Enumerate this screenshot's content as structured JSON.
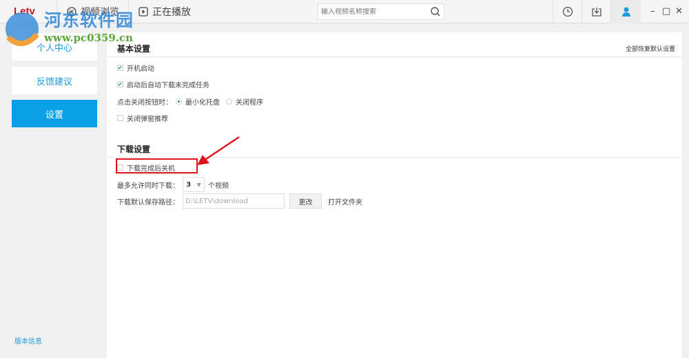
{
  "topbar": {
    "logo": "Letv",
    "tabs": [
      {
        "label": "视频浏览",
        "icon": "browse-icon"
      },
      {
        "label": "正在播放",
        "icon": "play-icon"
      }
    ],
    "search_placeholder": "输入视频名称搜索",
    "icons": [
      "history-icon",
      "download-icon",
      "user-icon"
    ],
    "window": {
      "minimize": "–",
      "maximize": "□",
      "close": "✕"
    },
    "accent": "#0aa0e6"
  },
  "sidebar": {
    "items": [
      {
        "label": "个人中心"
      },
      {
        "label": "反馈建议"
      },
      {
        "label": "设置",
        "active": true
      }
    ],
    "version": "版本信息"
  },
  "basic": {
    "title": "基本设置",
    "reset": "全部恢复默认设置",
    "autostart": {
      "label": "开机启动",
      "checked": true
    },
    "resume": {
      "label": "启动后自动下载未完成任务",
      "checked": true
    },
    "close_action": {
      "label": "点击关闭按钮时：",
      "options": [
        {
          "label": "最小化托盘",
          "selected": true
        },
        {
          "label": "关闭程序",
          "selected": false
        }
      ]
    },
    "popup": {
      "label": "关闭弹窗推荐",
      "checked": false
    }
  },
  "download": {
    "title": "下载设置",
    "shutdown": {
      "label": "下载完成后关机",
      "checked": false
    },
    "max_label": "最多允许同时下载：",
    "max_value": "3",
    "max_unit": "个视频",
    "path_label": "下载默认保存路径：",
    "path_value": "D:\\LETV\\download",
    "change": "更改",
    "open_folder": "打开文件夹"
  },
  "watermark": {
    "name": "河东软件园",
    "url": "www.pc0359.cn"
  }
}
